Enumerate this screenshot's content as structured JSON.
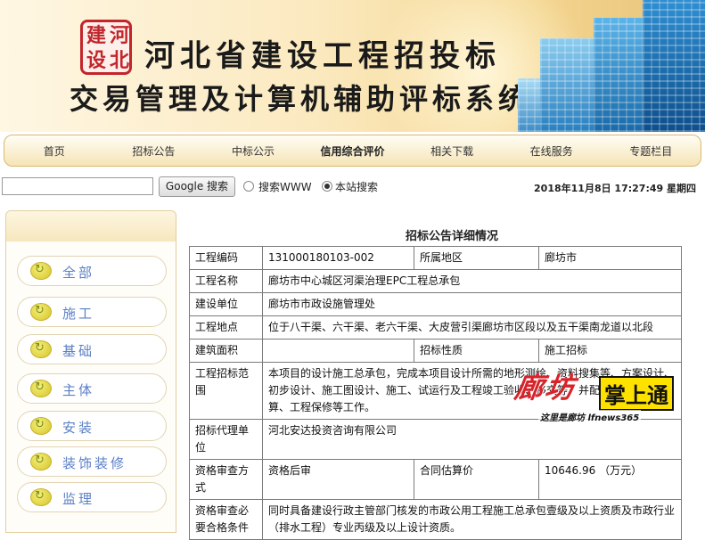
{
  "banner": {
    "seal_chars": [
      "建",
      "河",
      "设",
      "北"
    ],
    "title_line1": "河北省建设工程招投标",
    "title_line2": "交易管理及计算机辅助评标系统"
  },
  "nav": {
    "items": [
      "首页",
      "招标公告",
      "中标公示",
      "信用综合评价",
      "相关下载",
      "在线服务",
      "专题栏目"
    ],
    "active_index": 3
  },
  "search": {
    "input_value": "",
    "button_label": "Google 搜索",
    "options": [
      "搜索WWW",
      "本站搜索"
    ],
    "selected_option": "本站搜索"
  },
  "datetime": "2018年11月8日 17:27:49 星期四",
  "sidebar": {
    "items": [
      "全部",
      "施工",
      "基础",
      "主体",
      "安装",
      "装饰装修",
      "监理"
    ]
  },
  "detail": {
    "title": "招标公告详细情况",
    "rows": [
      {
        "l1": "工程编码",
        "v1": "131000180103-002",
        "l2": "所属地区",
        "v2": "廊坊市"
      },
      {
        "l1": "工程名称",
        "v": "廊坊市中心城区河渠治理EPC工程总承包"
      },
      {
        "l1": "建设单位",
        "v": "廊坊市市政设施管理处"
      },
      {
        "l1": "工程地点",
        "v": "位于八干渠、六干渠、老六干渠、大皮营引渠廊坊市区段以及五干渠南龙道以北段"
      },
      {
        "l1": "建筑面积",
        "v1": "",
        "l2": "招标性质",
        "v2": "施工招标"
      },
      {
        "l1": "工程招标范围",
        "v": "本项目的设计施工总承包，完成本项目设计所需的地形测绘、资料搜集等、方案设计、初步设计、施工图设计、施工、试运行及工程竣工验收、移交等，并配合相关部门结算、工程保修等工作。"
      },
      {
        "l1": "招标代理单位",
        "v": "河北安达投资咨询有限公司"
      },
      {
        "l1": "资格审查方式",
        "v1": "资格后审",
        "l2": "合同估算价",
        "v2": "10646.96 （万元）"
      },
      {
        "l1": "资格审查必要合格条件",
        "v": "同时具备建设行政主管部门核发的市政公用工程施工总承包壹级及以上资质及市政行业（排水工程）专业丙级及以上设计资质。"
      }
    ]
  },
  "watermark": {
    "brand": "廊坊",
    "badge": "掌上通",
    "tagline": "这里是廊坊  lfnews365"
  }
}
